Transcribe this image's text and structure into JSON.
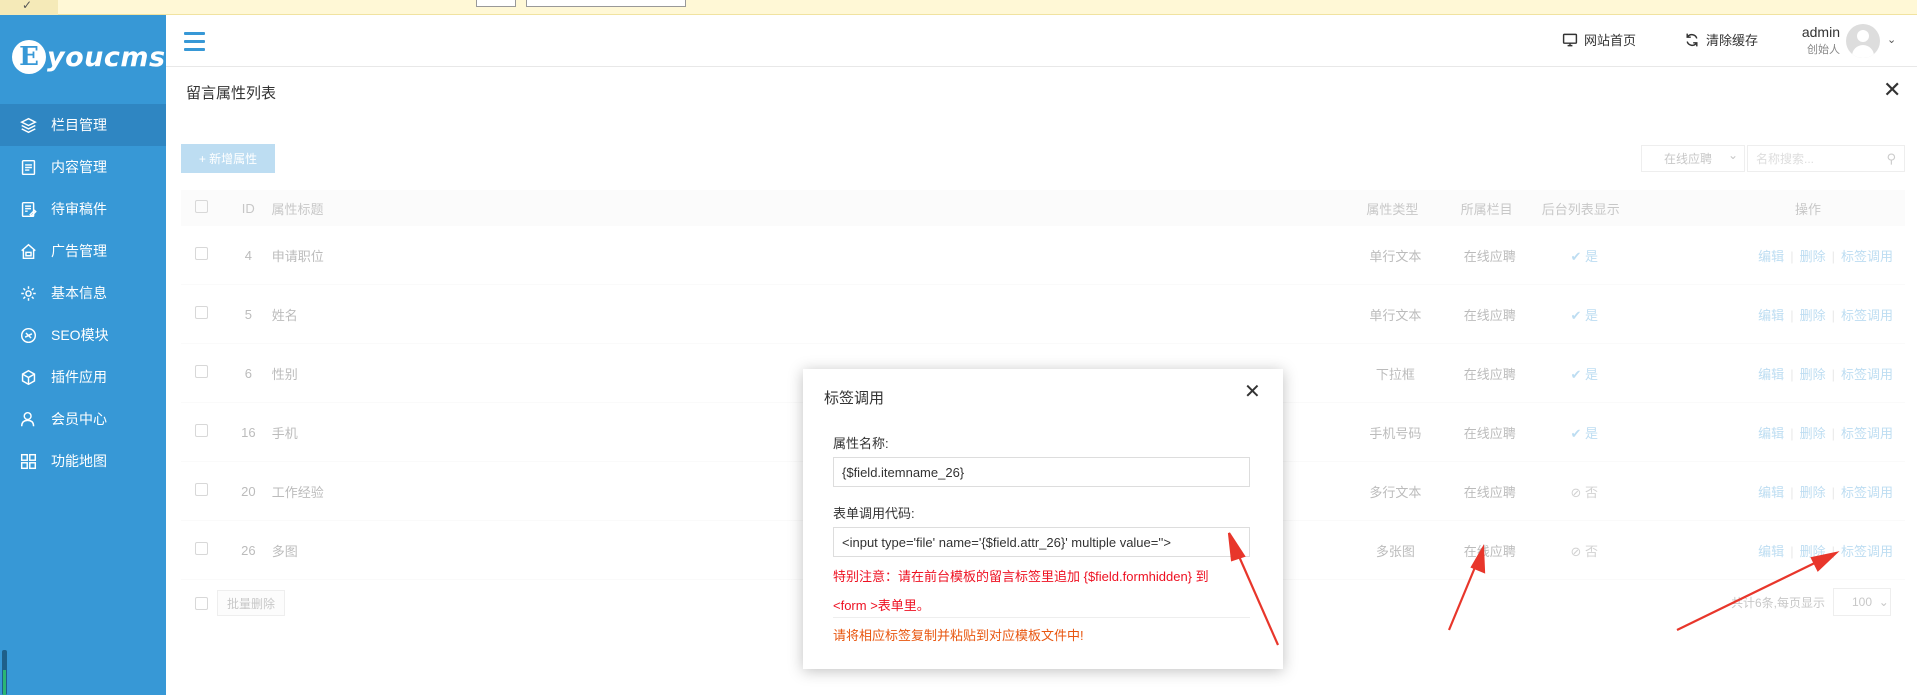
{
  "brand": {
    "logo_letter": "E",
    "logo_text": "youcms"
  },
  "sidebar": {
    "items": [
      {
        "label": "栏目管理",
        "icon": "layers-icon",
        "active": true
      },
      {
        "label": "内容管理",
        "icon": "document-icon",
        "active": false
      },
      {
        "label": "待审稿件",
        "icon": "edit-document-icon",
        "active": false
      },
      {
        "label": "广告管理",
        "icon": "home-ad-icon",
        "active": false
      },
      {
        "label": "基本信息",
        "icon": "gear-icon",
        "active": false
      },
      {
        "label": "SEO模块",
        "icon": "seo-icon",
        "active": false
      },
      {
        "label": "插件应用",
        "icon": "cube-icon",
        "active": false
      },
      {
        "label": "会员中心",
        "icon": "user-icon",
        "active": false
      },
      {
        "label": "功能地图",
        "icon": "grid-icon",
        "active": false
      }
    ]
  },
  "topbar": {
    "site_home": "网站首页",
    "clear_cache": "清除缓存",
    "user_name": "admin",
    "user_role": "创始人"
  },
  "page": {
    "title": "留言属性列表",
    "add_button": "+ 新增属性",
    "filter_select": "在线应聘",
    "search_placeholder": "名称搜索..."
  },
  "table": {
    "headers": {
      "id": "ID",
      "title": "属性标题",
      "type": "属性类型",
      "column": "所属栏目",
      "show": "后台列表显示",
      "ops": "操作"
    },
    "rows": [
      {
        "id": "4",
        "title": "申请职位",
        "type": "单行文本",
        "column": "在线应聘",
        "show": "是"
      },
      {
        "id": "5",
        "title": "姓名",
        "type": "单行文本",
        "column": "在线应聘",
        "show": "是"
      },
      {
        "id": "6",
        "title": "性别",
        "type": "下拉框",
        "column": "在线应聘",
        "show": "是"
      },
      {
        "id": "16",
        "title": "手机",
        "type": "手机号码",
        "column": "在线应聘",
        "show": "是"
      },
      {
        "id": "20",
        "title": "工作经验",
        "type": "多行文本",
        "column": "在线应聘",
        "show": "否"
      },
      {
        "id": "26",
        "title": "多图",
        "type": "多张图",
        "column": "在线应聘",
        "show": "否"
      }
    ],
    "op_edit": "编辑",
    "op_delete": "删除",
    "op_tag": "标签调用"
  },
  "footer": {
    "batch_delete": "批量删除",
    "info": "共计6条,每页显示",
    "per_page": "100"
  },
  "modal": {
    "title": "标签调用",
    "name_label": "属性名称:",
    "name_value": "{$field.itemname_26}",
    "code_label": "表单调用代码:",
    "code_value": "<input type='file' name='{$field.attr_26}' multiple value=''>",
    "note_line1": "特别注意：请在前台模板的留言标签里追加 {$field.formhidden} 到",
    "note_line2": "<form >表单里。",
    "tip": "请将相应标签复制并粘贴到对应模板文件中!"
  },
  "colors": {
    "sidebar": "#3798d6",
    "active": "#2f86c2",
    "arrow": "#e8362b",
    "warning": "#e12222"
  }
}
